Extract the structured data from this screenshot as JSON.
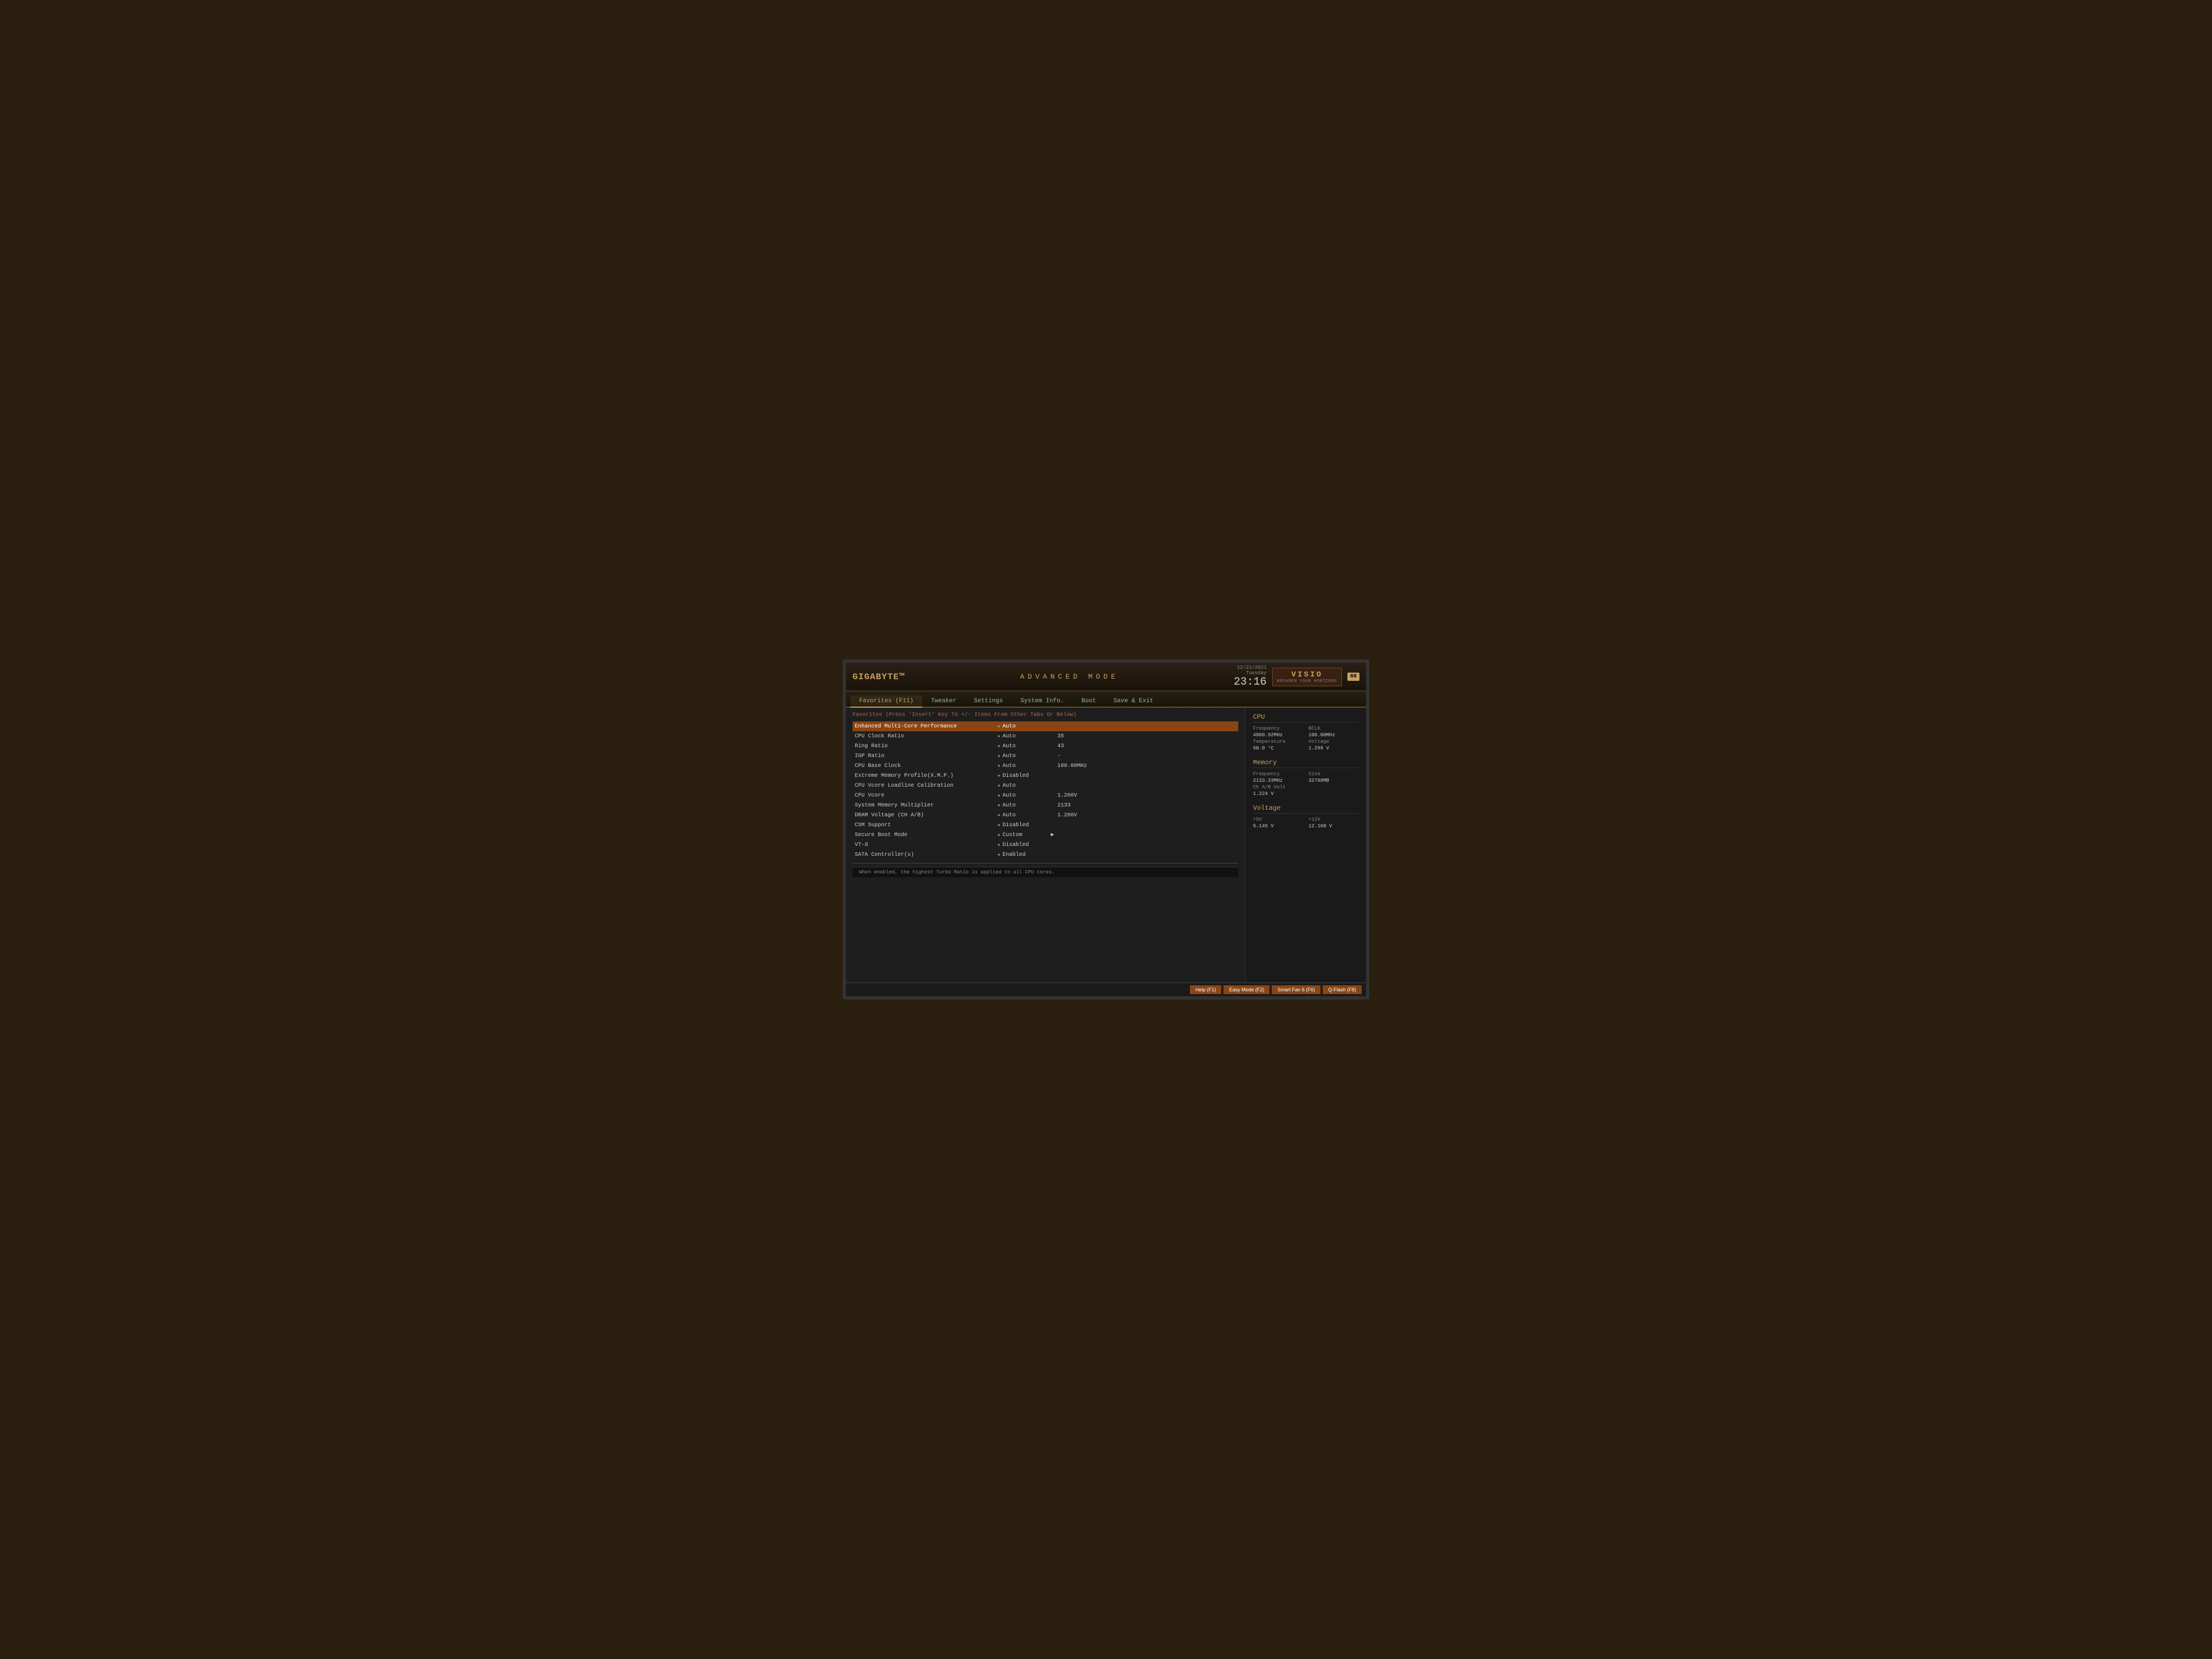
{
  "header": {
    "logo": "GIGABYTE™",
    "title": "ADVANCED  MODE",
    "date": "12/21/2021",
    "day": "Tuesday",
    "time": "23:16",
    "brand": "VISIO",
    "brand_sub": "BROADEN YOUR HORIZONS",
    "fps": "60"
  },
  "nav": {
    "tabs": [
      {
        "label": "Favorites (F11)",
        "active": true
      },
      {
        "label": "Tweaker",
        "active": false
      },
      {
        "label": "Settings",
        "active": false
      },
      {
        "label": "System Info.",
        "active": false
      },
      {
        "label": "Boot",
        "active": false
      },
      {
        "label": "Save & Exit",
        "active": false
      }
    ]
  },
  "favorites": {
    "section_header": "Favorites (Press 'Insert' Key To +/- Items From Other Tabs Or Below)",
    "rows": [
      {
        "name": "Enhanced Multi-Core Performance",
        "value": "Auto",
        "extra": "",
        "starred": true,
        "highlighted": true
      },
      {
        "name": "CPU Clock Ratio",
        "value": "Auto",
        "extra": "35",
        "starred": true,
        "highlighted": false
      },
      {
        "name": "Ring Ratio",
        "value": "Auto",
        "extra": "43",
        "starred": true,
        "highlighted": false
      },
      {
        "name": "IGP Ratio",
        "value": "Auto",
        "extra": "-",
        "starred": true,
        "highlighted": false
      },
      {
        "name": "CPU Base Clock",
        "value": "Auto",
        "extra": "100.00MHz",
        "starred": true,
        "highlighted": false
      },
      {
        "name": "Extreme Memory Profile(X.M.P.)",
        "value": "Disabled",
        "extra": "",
        "starred": true,
        "highlighted": false
      },
      {
        "name": "CPU Vcore Loadline Calibration",
        "value": "Auto",
        "extra": "",
        "starred": true,
        "highlighted": false
      },
      {
        "name": "CPU Vcore",
        "value": "Auto",
        "extra": "1.200V",
        "starred": true,
        "highlighted": false
      },
      {
        "name": "System Memory Multiplier",
        "value": "Auto",
        "extra": "2133",
        "starred": true,
        "highlighted": false
      },
      {
        "name": "DRAM Voltage    (CH A/B)",
        "value": "Auto",
        "extra": "1.200V",
        "starred": true,
        "highlighted": false
      },
      {
        "name": "CSM Support",
        "value": "Disabled",
        "extra": "",
        "starred": true,
        "highlighted": false
      },
      {
        "name": "Secure Boot Mode",
        "value": "Custom",
        "extra": "",
        "starred": true,
        "highlighted": false,
        "cursor": true
      },
      {
        "name": "VT-d",
        "value": "Disabled",
        "extra": "",
        "starred": true,
        "highlighted": false
      },
      {
        "name": "SATA Controller(s)",
        "value": "Enabled",
        "extra": "",
        "starred": true,
        "highlighted": false
      }
    ],
    "help_text": "When enabled, the highest Turbo Ratio is applied to all CPU cores."
  },
  "cpu_info": {
    "title": "CPU",
    "frequency_label": "Frequency",
    "frequency_value": "4800.92MHz",
    "bclk_label": "BCLK",
    "bclk_value": "100.00MHz",
    "temperature_label": "Temperature",
    "temperature_value": "50.0 °C",
    "voltage_label": "Voltage",
    "voltage_value": "1.299 V"
  },
  "memory_info": {
    "title": "Memory",
    "frequency_label": "Frequency",
    "frequency_value": "2133.33MHz",
    "size_label": "Size",
    "size_value": "32768MB",
    "chavb_label": "Ch A/B Volt",
    "chavb_value": "1.224 V"
  },
  "voltage_info": {
    "title": "Voltage",
    "v5_label": "+5V",
    "v5_value": "5.145 V",
    "v12_label": "+12V",
    "v12_value": "12.168 V"
  },
  "bottom_buttons": [
    {
      "label": "Help (F1)"
    },
    {
      "label": "Easy Mode (F2)"
    },
    {
      "label": "Smart Fan 6 (F6)"
    },
    {
      "label": "Q-Flash (F8)"
    }
  ]
}
